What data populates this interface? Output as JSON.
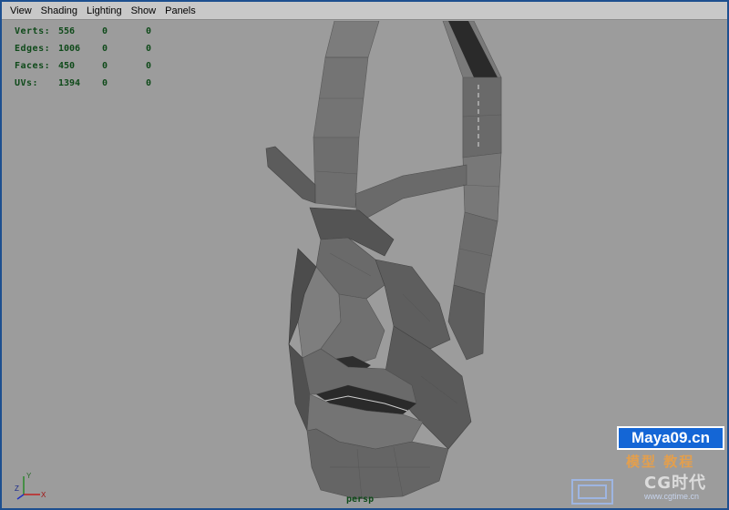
{
  "menu": {
    "items": [
      "View",
      "Shading",
      "Lighting",
      "Show",
      "Panels"
    ]
  },
  "hud": {
    "stats": [
      {
        "label": "Verts:",
        "v1": "556",
        "v2": "0",
        "v3": "0"
      },
      {
        "label": "Edges:",
        "v1": "1006",
        "v2": "0",
        "v3": "0"
      },
      {
        "label": "Faces:",
        "v1": "450",
        "v2": "0",
        "v3": "0"
      },
      {
        "label": "UVs:",
        "v1": "1394",
        "v2": "0",
        "v3": "0"
      }
    ],
    "camera": "persp"
  },
  "axis": {
    "y": "Y",
    "z": "Z",
    "x": "X"
  },
  "watermark": {
    "url_text": "Maya09.cn",
    "chinese_text": "模型 教程",
    "cg_text": "CG时代",
    "site_text": "www.cgtime.cn"
  },
  "colors": {
    "hud_text": "#0f4a1a",
    "viewport_bg": "#9c9c9c",
    "menubar_bg": "#c8c8c8",
    "frame_border": "#1d4f8f",
    "watermark_blue": "#1466d6"
  }
}
